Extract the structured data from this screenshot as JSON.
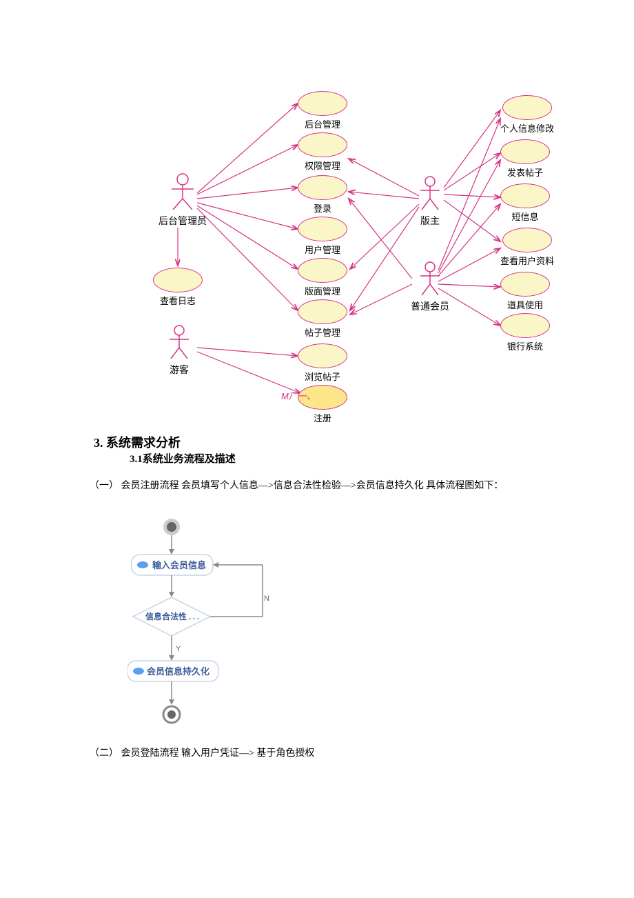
{
  "actors": {
    "admin": "后台管理员",
    "guest": "游客",
    "moderator": "版主",
    "member": "普通会员"
  },
  "usecases": {
    "backend_mgmt": "后台管理",
    "perm_mgmt": "权限管理",
    "login": "登录",
    "user_mgmt": "用户管理",
    "board_mgmt": "版面管理",
    "post_mgmt": "帖子管理",
    "browse_posts": "浏览帖子",
    "register": "注册",
    "view_logs": "查看日志",
    "edit_profile": "个人信息修改",
    "publish_post": "发表帖子",
    "short_msg": "短信息",
    "view_user": "查看用户资料",
    "use_item": "道具使用",
    "bank_system": "银行系统"
  },
  "scribble": "M厂一、",
  "headings": {
    "sec3": "3. 系统需求分析",
    "sec31": "3.1系统业务流程及描述"
  },
  "paragraphs": {
    "p1": "（一）  会员注册流程  会员填写个人信息—>信息合法性检验—>会员信息持久化  具体流程图如下：",
    "p2": "（二）  会员登陆流程  输入用户凭证—> 基于角色授权"
  },
  "flowchart": {
    "step1": "输入会员信息",
    "decision": "信息合法性 . . .",
    "branch_no": "N",
    "branch_yes": "Y",
    "step2": "会员信息持久化"
  }
}
